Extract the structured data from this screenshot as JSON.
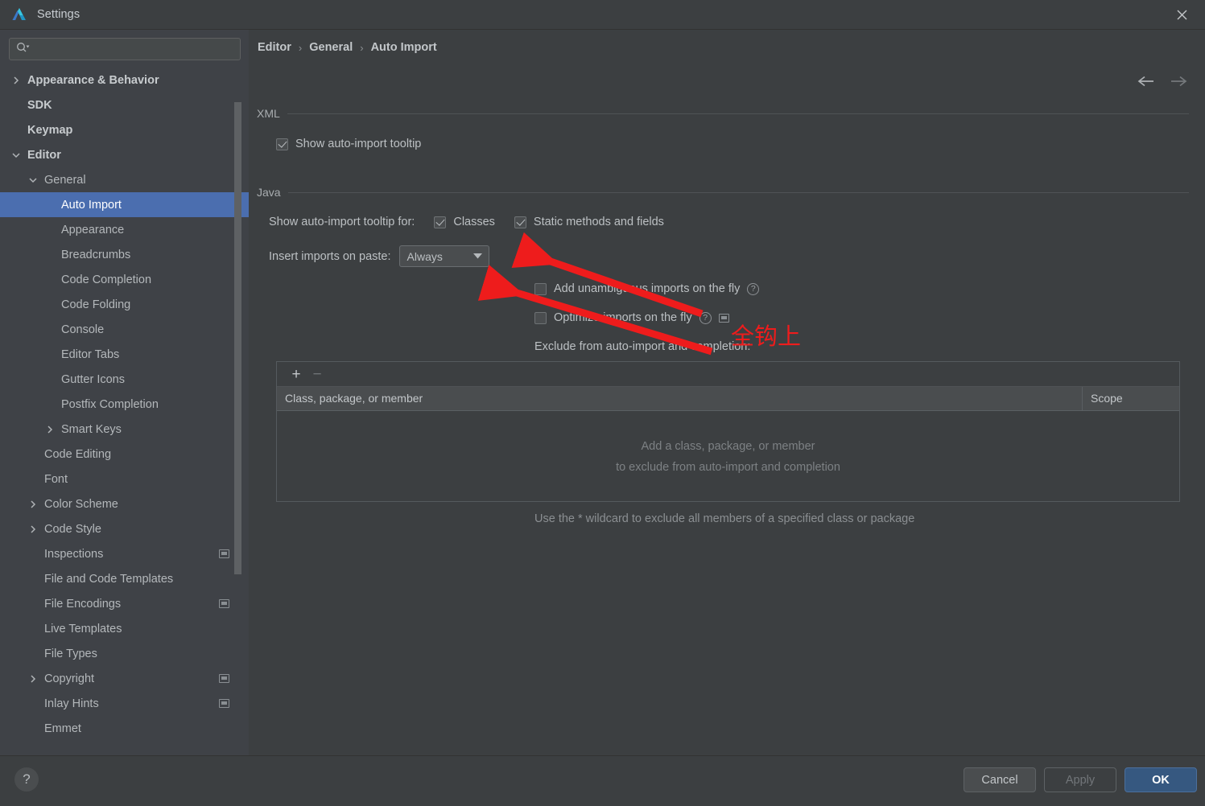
{
  "window": {
    "title": "Settings",
    "logo_icon": "android-studio-logo",
    "close_icon": "close-icon"
  },
  "sidebar": {
    "search": {
      "placeholder": "",
      "value": "",
      "icon": "search-icon"
    },
    "items": [
      {
        "label": "Appearance & Behavior",
        "indent": 0,
        "arrow": "right",
        "bold": true,
        "badge": false,
        "selected": false
      },
      {
        "label": "SDK",
        "indent": 0,
        "arrow": "none",
        "bold": true,
        "badge": false,
        "selected": false
      },
      {
        "label": "Keymap",
        "indent": 0,
        "arrow": "none",
        "bold": true,
        "badge": false,
        "selected": false
      },
      {
        "label": "Editor",
        "indent": 0,
        "arrow": "down",
        "bold": true,
        "badge": false,
        "selected": false
      },
      {
        "label": "General",
        "indent": 1,
        "arrow": "down",
        "bold": false,
        "badge": false,
        "selected": false
      },
      {
        "label": "Auto Import",
        "indent": 2,
        "arrow": "none",
        "bold": false,
        "badge": false,
        "selected": true
      },
      {
        "label": "Appearance",
        "indent": 2,
        "arrow": "none",
        "bold": false,
        "badge": false,
        "selected": false
      },
      {
        "label": "Breadcrumbs",
        "indent": 2,
        "arrow": "none",
        "bold": false,
        "badge": false,
        "selected": false
      },
      {
        "label": "Code Completion",
        "indent": 2,
        "arrow": "none",
        "bold": false,
        "badge": false,
        "selected": false
      },
      {
        "label": "Code Folding",
        "indent": 2,
        "arrow": "none",
        "bold": false,
        "badge": false,
        "selected": false
      },
      {
        "label": "Console",
        "indent": 2,
        "arrow": "none",
        "bold": false,
        "badge": false,
        "selected": false
      },
      {
        "label": "Editor Tabs",
        "indent": 2,
        "arrow": "none",
        "bold": false,
        "badge": false,
        "selected": false
      },
      {
        "label": "Gutter Icons",
        "indent": 2,
        "arrow": "none",
        "bold": false,
        "badge": false,
        "selected": false
      },
      {
        "label": "Postfix Completion",
        "indent": 2,
        "arrow": "none",
        "bold": false,
        "badge": false,
        "selected": false
      },
      {
        "label": "Smart Keys",
        "indent": 2,
        "arrow": "right",
        "bold": false,
        "badge": false,
        "selected": false
      },
      {
        "label": "Code Editing",
        "indent": 1,
        "arrow": "none",
        "bold": false,
        "badge": false,
        "selected": false
      },
      {
        "label": "Font",
        "indent": 1,
        "arrow": "none",
        "bold": false,
        "badge": false,
        "selected": false
      },
      {
        "label": "Color Scheme",
        "indent": 1,
        "arrow": "right",
        "bold": false,
        "badge": false,
        "selected": false
      },
      {
        "label": "Code Style",
        "indent": 1,
        "arrow": "right",
        "bold": false,
        "badge": false,
        "selected": false
      },
      {
        "label": "Inspections",
        "indent": 1,
        "arrow": "none",
        "bold": false,
        "badge": true,
        "selected": false
      },
      {
        "label": "File and Code Templates",
        "indent": 1,
        "arrow": "none",
        "bold": false,
        "badge": false,
        "selected": false
      },
      {
        "label": "File Encodings",
        "indent": 1,
        "arrow": "none",
        "bold": false,
        "badge": true,
        "selected": false
      },
      {
        "label": "Live Templates",
        "indent": 1,
        "arrow": "none",
        "bold": false,
        "badge": false,
        "selected": false
      },
      {
        "label": "File Types",
        "indent": 1,
        "arrow": "none",
        "bold": false,
        "badge": false,
        "selected": false
      },
      {
        "label": "Copyright",
        "indent": 1,
        "arrow": "right",
        "bold": false,
        "badge": true,
        "selected": false
      },
      {
        "label": "Inlay Hints",
        "indent": 1,
        "arrow": "none",
        "bold": false,
        "badge": true,
        "selected": false
      },
      {
        "label": "Emmet",
        "indent": 1,
        "arrow": "none",
        "bold": false,
        "badge": false,
        "selected": false
      }
    ]
  },
  "breadcrumb": {
    "crumbs": [
      "Editor",
      "General",
      "Auto Import"
    ],
    "separator": "›",
    "back_icon": "arrow-left-icon",
    "forward_icon": "arrow-right-icon"
  },
  "main": {
    "xml_group": {
      "title": "XML",
      "show_tooltip": {
        "label": "Show auto-import tooltip",
        "checked": true
      }
    },
    "java_group": {
      "title": "Java",
      "tooltip_for_label": "Show auto-import tooltip for:",
      "classes": {
        "label": "Classes",
        "checked": true
      },
      "static_members": {
        "label": "Static methods and fields",
        "checked": true
      },
      "insert_on_paste_label": "Insert imports on paste:",
      "insert_on_paste_value": "Always",
      "insert_on_paste_options": [
        "Always"
      ],
      "add_unambiguous": {
        "label": "Add unambiguous imports on the fly",
        "checked": false,
        "help_icon": "help-circle-icon"
      },
      "optimize_imports": {
        "label": "Optimize imports on the fly",
        "checked": false,
        "help_icon": "help-circle-icon",
        "scope_icon": "project-scope-icon"
      },
      "exclude_label": "Exclude from auto-import and completion:",
      "table": {
        "add_button": "+",
        "remove_button": "−",
        "columns": [
          "Class, package, or member",
          "Scope"
        ],
        "rows": [],
        "empty_line1": "Add a class, package, or member",
        "empty_line2": "to exclude from auto-import and completion"
      },
      "wildcard_hint": "Use the * wildcard to exclude all members of a specified class or package"
    }
  },
  "annotations": {
    "note_text": "全钩上",
    "note_color": "#ee1c1c",
    "arrows": 2
  },
  "footer": {
    "help_label": "?",
    "cancel_label": "Cancel",
    "apply_label": "Apply",
    "ok_label": "OK"
  }
}
